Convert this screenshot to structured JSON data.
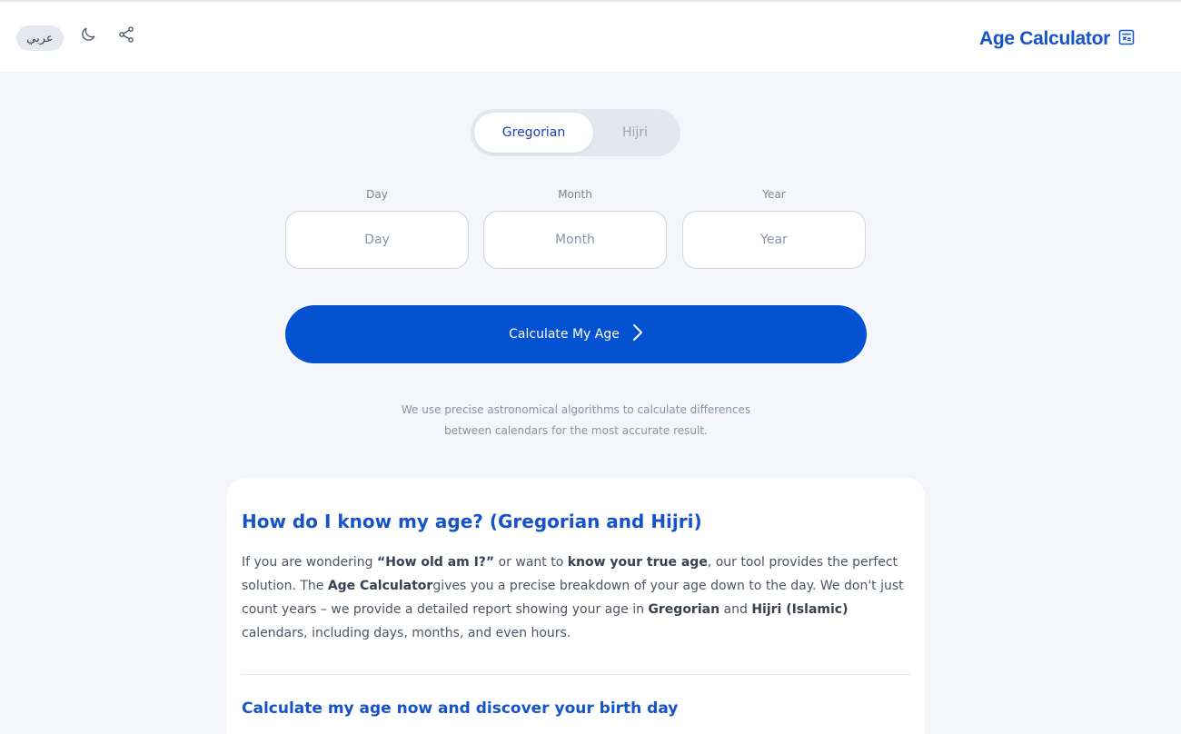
{
  "header": {
    "lang_label": "عربي",
    "brand_title": "Age Calculator"
  },
  "calendar_toggle": {
    "options": [
      "Gregorian",
      "Hijri"
    ],
    "selected": "Gregorian"
  },
  "fields": {
    "day": {
      "label": "Day",
      "placeholder": "Day",
      "value": ""
    },
    "month": {
      "label": "Month",
      "placeholder": "Month",
      "value": ""
    },
    "year": {
      "label": "Year",
      "placeholder": "Year",
      "value": ""
    }
  },
  "calculate_button": {
    "label": "Calculate My Age"
  },
  "note": {
    "line1": "We use precise astronomical algorithms to calculate differences",
    "line2": "between calendars for the most accurate result."
  },
  "article": {
    "heading": "How do I know my age? (Gregorian and Hijri)",
    "p_1": "If you are wondering ",
    "b_1": "“How old am I?”",
    "p_2": " or want to ",
    "b_2": "know your true age",
    "p_3": ", our tool provides the perfect solution. The ",
    "b_3": "Age Calculator",
    "p_4": "gives you a precise breakdown of your age down to the day. We don't just count years – we provide a detailed report showing your age in ",
    "b_4": "Gregorian",
    "p_5": " and ",
    "b_5": "Hijri (Islamic)",
    "p_6": " calendars, including days, months, and even hours.",
    "subheading": "Calculate my age now and discover your birth day"
  },
  "icons": {
    "moon": "moon-icon",
    "share": "share-icon",
    "calculator": "calculator-icon",
    "chevron": "chevron-right-icon"
  },
  "colors": {
    "accent": "#0451d1",
    "brand": "#1553c7",
    "background": "#f4f6f9"
  }
}
